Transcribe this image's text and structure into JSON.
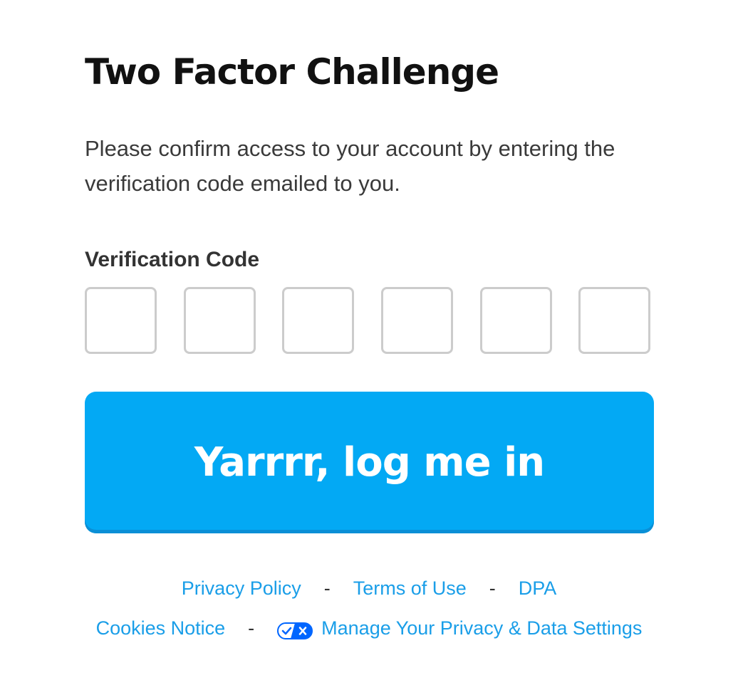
{
  "page": {
    "title": "Two Factor Challenge",
    "description": "Please confirm access to your account by entering the verification code emailed to you."
  },
  "form": {
    "code_label": "Verification Code",
    "code_boxes": [
      "",
      "",
      "",
      "",
      "",
      ""
    ],
    "submit_label": "Yarrrr, log me in"
  },
  "footer": {
    "row1": {
      "privacy_policy": "Privacy Policy",
      "sep1": "-",
      "terms_of_use": "Terms of Use",
      "sep2": "-",
      "dpa": "DPA"
    },
    "row2": {
      "cookies_notice": "Cookies Notice",
      "sep1": "-",
      "privacy_toggle_icon": "privacy-choices-icon",
      "manage_privacy": "Manage Your Privacy & Data Settings"
    }
  },
  "colors": {
    "accent": "#03a9f4",
    "link": "#1a9ee8",
    "box_border": "#cccccc",
    "title": "#111111"
  }
}
